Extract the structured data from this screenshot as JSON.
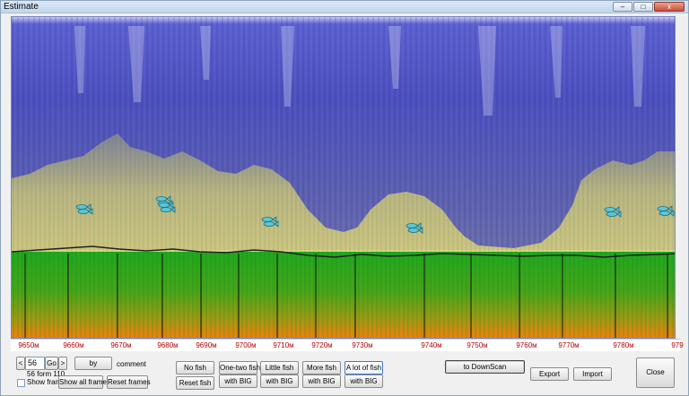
{
  "window": {
    "title": "Estimate",
    "controls": {
      "minimize": "–",
      "maximize": "□",
      "close": "x"
    }
  },
  "sonar": {
    "colors": {
      "water_top": "#4b4fc0",
      "water_mid": "#5a5fbd",
      "fish_cloud": "#c8c27a",
      "bottom_top": "#21a81f",
      "bottom_bottom": "#f07f12",
      "bottom_line": "#101010"
    },
    "fish_icon": "fish-icon",
    "fish_count": 7
  },
  "scale": {
    "ticks": [
      "9650м",
      "9660м",
      "9670м",
      "9680м",
      "9690м",
      "9700м",
      "9710м",
      "9720м",
      "9730м",
      "9740м",
      "9750м",
      "9760м",
      "9770м",
      "9780м",
      "979"
    ]
  },
  "frame_nav": {
    "prev_label": "<",
    "frame_value": "56",
    "go_label": "Go",
    "next_label": ">",
    "info": "56 form 110",
    "by_label": "by",
    "comment_label": "comment",
    "show_frame_label": "Show frame",
    "show_frame_checked": false,
    "show_all_frames_label": "Show all frames",
    "reset_frames_label": "Reset frames"
  },
  "fish_buttons": {
    "no_fish": "No fish",
    "reset_fish": "Reset fish",
    "one_two_fish": "One-two fish",
    "with_big_1": "with BIG",
    "little_fish": "Little fish",
    "with_big_2": "with BIG",
    "more_fish": "More fish",
    "with_big_3": "with BIG",
    "a_lot_of_fish": "A lot of fish",
    "with_big_4": "with BIG",
    "selected": "a_lot_of_fish"
  },
  "actions": {
    "to_downscan": "to DownScan",
    "export": "Export",
    "import": "Import",
    "close": "Close"
  }
}
